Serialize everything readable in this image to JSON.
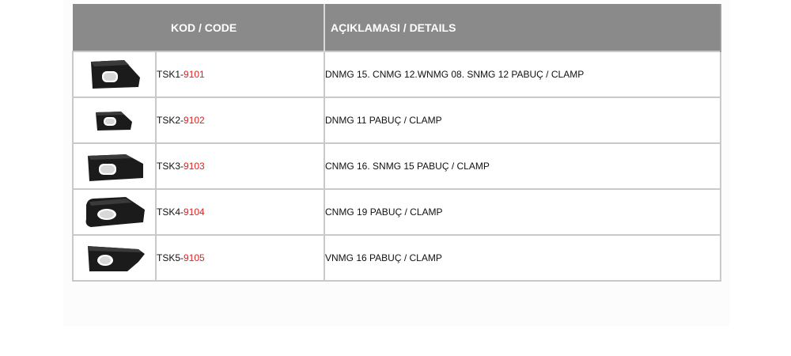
{
  "table": {
    "headers": {
      "code": "KOD / CODE",
      "details": "AÇIKLAMASI / DETAILS"
    },
    "rows": [
      {
        "code_prefix": "TSK1-",
        "code_number": "9101",
        "details": "DNMG 15. CNMG 12.WNMG 08. SNMG 12 PABUÇ / CLAMP",
        "image_icon": "clamp-1-icon"
      },
      {
        "code_prefix": "TSK2-",
        "code_number": "9102",
        "details": "DNMG 11 PABUÇ / CLAMP",
        "image_icon": "clamp-2-icon"
      },
      {
        "code_prefix": "TSK3-",
        "code_number": "9103",
        "details": "CNMG 16. SNMG 15 PABUÇ / CLAMP",
        "image_icon": "clamp-3-icon"
      },
      {
        "code_prefix": "TSK4-",
        "code_number": "9104",
        "details": "CNMG 19 PABUÇ / CLAMP",
        "image_icon": "clamp-4-icon"
      },
      {
        "code_prefix": "TSK5-",
        "code_number": "9105",
        "details": "VNMG 16 PABUÇ / CLAMP",
        "image_icon": "clamp-5-icon"
      }
    ]
  },
  "colors": {
    "header_bg": "#8a8a8b",
    "header_text": "#ffffff",
    "code_number": "#e02020",
    "clamp_body": "#1a1a1a"
  }
}
